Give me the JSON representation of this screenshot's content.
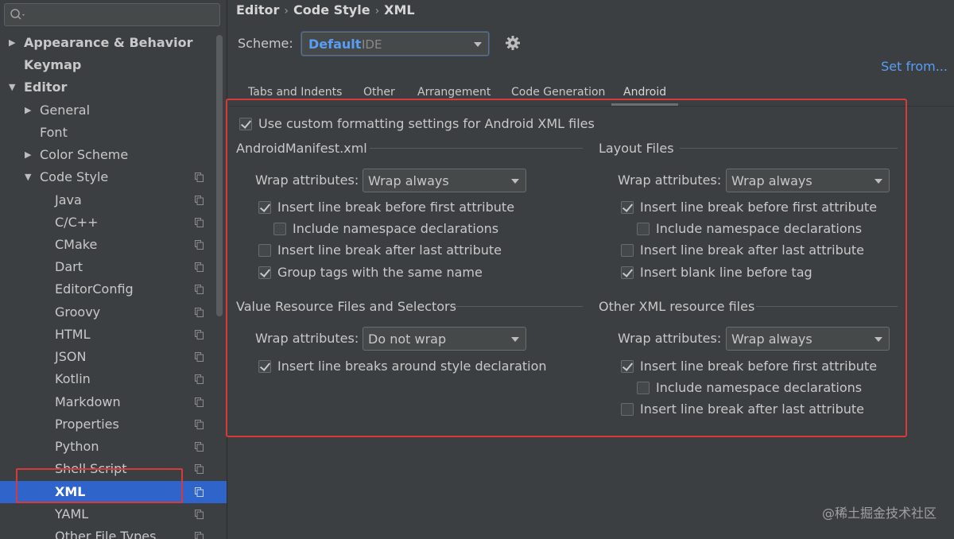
{
  "sidebar": {
    "search": {
      "value": ""
    },
    "items": [
      {
        "label": "Appearance & Behavior",
        "arrow": "▶"
      },
      {
        "label": "Keymap"
      },
      {
        "label": "Editor",
        "arrow": "▼"
      },
      {
        "label": "General",
        "arrow": "▶"
      },
      {
        "label": "Font"
      },
      {
        "label": "Color Scheme",
        "arrow": "▶"
      },
      {
        "label": "Code Style",
        "arrow": "▼"
      },
      {
        "label": "Java"
      },
      {
        "label": "C/C++"
      },
      {
        "label": "CMake"
      },
      {
        "label": "Dart"
      },
      {
        "label": "EditorConfig"
      },
      {
        "label": "Groovy"
      },
      {
        "label": "HTML"
      },
      {
        "label": "JSON"
      },
      {
        "label": "Kotlin"
      },
      {
        "label": "Markdown"
      },
      {
        "label": "Properties"
      },
      {
        "label": "Python"
      },
      {
        "label": "Shell Script"
      },
      {
        "label": "XML"
      },
      {
        "label": "YAML"
      },
      {
        "label": "Other File Types"
      }
    ]
  },
  "breadcrumb": {
    "part1": "Editor",
    "part2": "Code Style",
    "part3": "XML",
    "sep": "›"
  },
  "scheme": {
    "label": "Scheme:",
    "value": "Default",
    "sub": "IDE"
  },
  "set_from": "Set from...",
  "tabs": [
    "Tabs and Indents",
    "Other",
    "Arrangement",
    "Code Generation",
    "Android"
  ],
  "android": {
    "use_custom": "Use custom formatting settings for Android XML files",
    "manifest": {
      "title": "AndroidManifest.xml",
      "wrap_label": "Wrap attributes:",
      "wrap_value": "Wrap always",
      "opt1": "Insert line break before first attribute",
      "opt2": "Include namespace declarations",
      "opt3": "Insert line break after last attribute",
      "opt4": "Group tags with the same name"
    },
    "layout": {
      "title": "Layout Files",
      "wrap_label": "Wrap attributes:",
      "wrap_value": "Wrap always",
      "opt1": "Insert line break before first attribute",
      "opt2": "Include namespace declarations",
      "opt3": "Insert line break after last attribute",
      "opt4": "Insert blank line before tag"
    },
    "value_res": {
      "title": "Value Resource Files and Selectors",
      "wrap_label": "Wrap attributes:",
      "wrap_value": "Do not wrap",
      "opt1": "Insert line breaks around style declaration"
    },
    "other_xml": {
      "title": "Other XML resource files",
      "wrap_label": "Wrap attributes:",
      "wrap_value": "Wrap always",
      "opt1": "Insert line break before first attribute",
      "opt2": "Include namespace declarations",
      "opt3": "Insert line break after last attribute"
    }
  },
  "watermark": "@稀土掘金技术社区",
  "colors": {
    "accent": "#589df6",
    "selection": "#2f65ca",
    "highlight_box": "#d73a3a",
    "background": "#3c3f41"
  }
}
